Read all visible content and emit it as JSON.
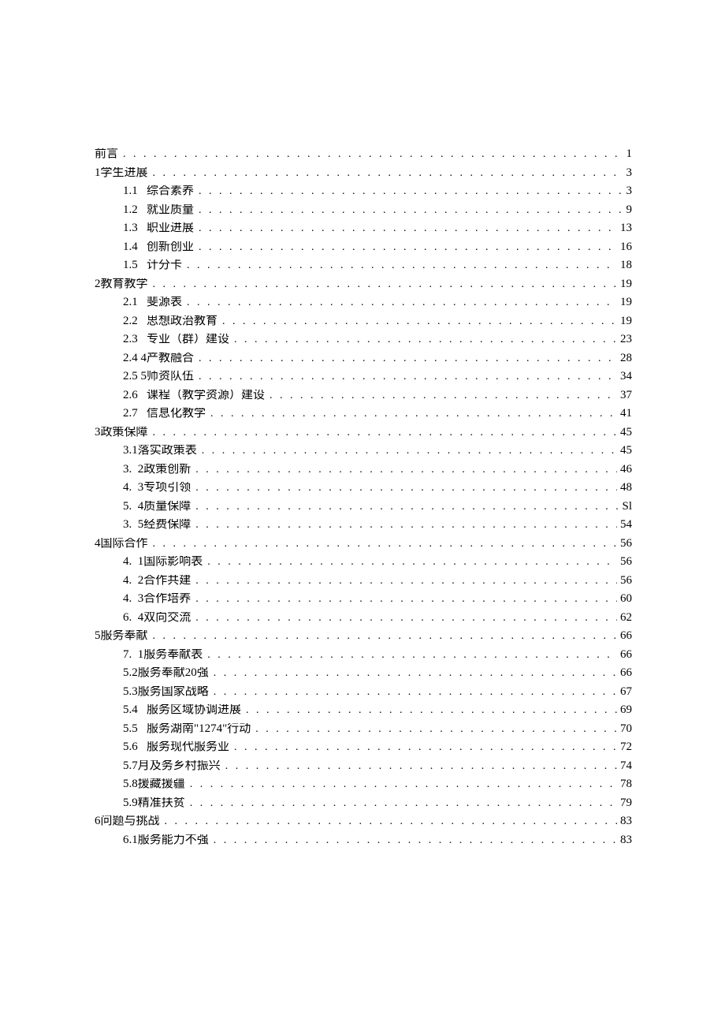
{
  "toc": [
    {
      "level": 0,
      "num": "",
      "gap": "",
      "title": "前言",
      "page": "1"
    },
    {
      "level": 0,
      "num": "1",
      "gap": "",
      "title": "学生进展",
      "page": "3"
    },
    {
      "level": 1,
      "num": "1.1",
      "gap": "   ",
      "title": "综合素养",
      "page": "3"
    },
    {
      "level": 1,
      "num": "1.2",
      "gap": "   ",
      "title": "就业质量",
      "page": "9"
    },
    {
      "level": 1,
      "num": "1.3",
      "gap": "   ",
      "title": "职业进展",
      "page": "13"
    },
    {
      "level": 1,
      "num": "1.4",
      "gap": "   ",
      "title": "创新创业",
      "page": "16"
    },
    {
      "level": 1,
      "num": "1.5",
      "gap": "   ",
      "title": "计分卡",
      "page": "18"
    },
    {
      "level": 0,
      "num": "2",
      "gap": "",
      "title": "教育教学",
      "page": "19"
    },
    {
      "level": 1,
      "num": "2.1",
      "gap": "   ",
      "title": "斐源表",
      "page": "19"
    },
    {
      "level": 1,
      "num": "2.2",
      "gap": "   ",
      "title": "思想政治教育",
      "page": "19"
    },
    {
      "level": 1,
      "num": "2.3",
      "gap": "   ",
      "title": "专业（群）建设",
      "page": "23"
    },
    {
      "level": 1,
      "num": "2.4",
      "gap": " ",
      "title": "4产教融合",
      "page": "28"
    },
    {
      "level": 1,
      "num": "2.5",
      "gap": " ",
      "title": "5师资队伍",
      "page": "34"
    },
    {
      "level": 1,
      "num": "2.6",
      "gap": "   ",
      "title": "课程（教学资源）建设",
      "page": "37"
    },
    {
      "level": 1,
      "num": "2.7",
      "gap": "   ",
      "title": "信息化教学",
      "page": "41"
    },
    {
      "level": 0,
      "num": "3",
      "gap": "",
      "title": "政策保障",
      "page": "45"
    },
    {
      "level": 1,
      "num": "3.1",
      "gap": "",
      "title": "落实政策表",
      "page": "45"
    },
    {
      "level": 1,
      "num": "3.",
      "gap": "  ",
      "title": "2政策创新",
      "page": "46"
    },
    {
      "level": 1,
      "num": "4.",
      "gap": "  ",
      "title": "3专项引领",
      "page": "48"
    },
    {
      "level": 1,
      "num": "5.",
      "gap": "  ",
      "title": "4质量保障",
      "page": "Sl"
    },
    {
      "level": 1,
      "num": "3.",
      "gap": "  ",
      "title": "5经费保障",
      "page": "54"
    },
    {
      "level": 0,
      "num": "4",
      "gap": "",
      "title": "国际合作",
      "page": "56"
    },
    {
      "level": 1,
      "num": "4.",
      "gap": "  ",
      "title": "1国际影响表",
      "page": "56"
    },
    {
      "level": 1,
      "num": "4.",
      "gap": "  ",
      "title": "2合作共建",
      "page": "56"
    },
    {
      "level": 1,
      "num": "4.",
      "gap": "  ",
      "title": "3合作培养",
      "page": "60"
    },
    {
      "level": 1,
      "num": "6.",
      "gap": "  ",
      "title": "4双向交流",
      "page": "62"
    },
    {
      "level": 0,
      "num": "5",
      "gap": "",
      "title": "服务奉献",
      "page": "66"
    },
    {
      "level": 1,
      "num": "7.",
      "gap": "  ",
      "title": "1服务奉献表",
      "page": "66"
    },
    {
      "level": 1,
      "num": "5.2",
      "gap": "",
      "title": "服务奉献20强",
      "page": "66"
    },
    {
      "level": 1,
      "num": "5.3",
      "gap": "",
      "title": "服务国家战略",
      "page": "67"
    },
    {
      "level": 1,
      "num": "5.4",
      "gap": "   ",
      "title": "服务区域协调进展",
      "page": "69"
    },
    {
      "level": 1,
      "num": "5.5",
      "gap": "   ",
      "title": "服务湖南\"1274\"行动",
      "page": "70"
    },
    {
      "level": 1,
      "num": "5.6",
      "gap": "   ",
      "title": "服务现代服务业",
      "page": "72"
    },
    {
      "level": 1,
      "num": "5.7",
      "gap": "",
      "title": "月及务乡村振兴",
      "page": "74"
    },
    {
      "level": 1,
      "num": "5.8",
      "gap": "",
      "title": "援藏援疆",
      "page": "78"
    },
    {
      "level": 1,
      "num": "5.9",
      "gap": "",
      "title": "精准扶贫",
      "page": "79"
    },
    {
      "level": 0,
      "num": "6",
      "gap": "",
      "title": "问题与挑战",
      "page": "83"
    },
    {
      "level": 1,
      "num": "6.1",
      "gap": "",
      "title": "服务能力不强",
      "page": "83"
    }
  ]
}
